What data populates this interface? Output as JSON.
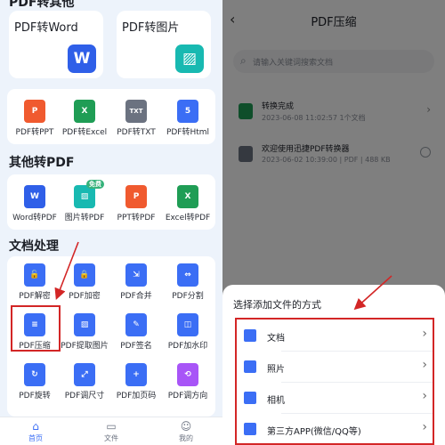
{
  "left": {
    "top_section_partial": "PDF转其他",
    "big_cards": [
      {
        "label": "PDF转Word",
        "icon": "W",
        "color": "#2f5fe8"
      },
      {
        "label": "PDF转图片",
        "icon": "▨",
        "color": "#18b9b1"
      }
    ],
    "convert_tiles": [
      {
        "label": "PDF转PPT",
        "icon": "P",
        "color": "#f05a2f"
      },
      {
        "label": "PDF转Excel",
        "icon": "X",
        "color": "#1f9d55"
      },
      {
        "label": "PDF转TXT",
        "icon": "TXT",
        "color": "#6b7280"
      },
      {
        "label": "PDF转Html",
        "icon": "5",
        "color": "#3b6ef5"
      }
    ],
    "other_section": "其他转PDF",
    "other_tiles": [
      {
        "label": "Word转PDF",
        "icon": "W",
        "color": "#2f5fe8",
        "badge": ""
      },
      {
        "label": "图片转PDF",
        "icon": "▨",
        "color": "#18b9b1",
        "badge": "免费"
      },
      {
        "label": "PPT转PDF",
        "icon": "P",
        "color": "#f05a2f",
        "badge": ""
      },
      {
        "label": "Excel转PDF",
        "icon": "X",
        "color": "#1f9d55",
        "badge": ""
      }
    ],
    "doc_section": "文档处理",
    "doc_tiles": [
      {
        "label": "PDF解密",
        "icon": "🔓",
        "color": "#3b6ef5"
      },
      {
        "label": "PDF加密",
        "icon": "🔒",
        "color": "#3b6ef5"
      },
      {
        "label": "PDF合并",
        "icon": "⇲",
        "color": "#3b6ef5"
      },
      {
        "label": "PDF分割",
        "icon": "⇔",
        "color": "#3b6ef5"
      },
      {
        "label": "PDF压缩",
        "icon": "≡",
        "color": "#3b6ef5"
      },
      {
        "label": "PDF提取图片",
        "icon": "▨",
        "color": "#3b6ef5"
      },
      {
        "label": "PDF签名",
        "icon": "✎",
        "color": "#3b6ef5"
      },
      {
        "label": "PDF加水印",
        "icon": "◫",
        "color": "#3b6ef5"
      },
      {
        "label": "PDF旋转",
        "icon": "↻",
        "color": "#3b6ef5"
      },
      {
        "label": "PDF调尺寸",
        "icon": "⤢",
        "color": "#3b6ef5"
      },
      {
        "label": "PDF加页码",
        "icon": "+",
        "color": "#3b6ef5"
      },
      {
        "label": "PDF调方向",
        "icon": "⟲",
        "color": "#a855f7"
      }
    ],
    "tabs": [
      {
        "label": "首页",
        "icon": "⌂",
        "active": true
      },
      {
        "label": "文件",
        "icon": "▭",
        "active": false
      },
      {
        "label": "我的",
        "icon": "☺",
        "active": false
      }
    ]
  },
  "right": {
    "title": "PDF压缩",
    "back_icon": "‹",
    "search_placeholder": "请输入关键词搜索文档",
    "files": [
      {
        "name": "转换完成",
        "meta": "2023-06-08 11:02:57  1个文档",
        "icon_color": "#1f9d55",
        "action": "›"
      },
      {
        "name": "欢迎使用迅捷PDF转换器",
        "meta": "2023-06-02 10:39:00 | PDF | 488 KB",
        "icon_color": "#6b7280",
        "action": "radio"
      }
    ],
    "sheet": {
      "title": "选择添加文件的方式",
      "options": [
        {
          "label": "文档",
          "icon": "doc-icon"
        },
        {
          "label": "照片",
          "icon": "photo-icon"
        },
        {
          "label": "相机",
          "icon": "camera-icon"
        },
        {
          "label": "第三方APP(微信/QQ等)",
          "icon": "app-icon"
        }
      ],
      "chevron": "›"
    }
  },
  "annotations": {
    "highlight_color": "#d32626"
  }
}
